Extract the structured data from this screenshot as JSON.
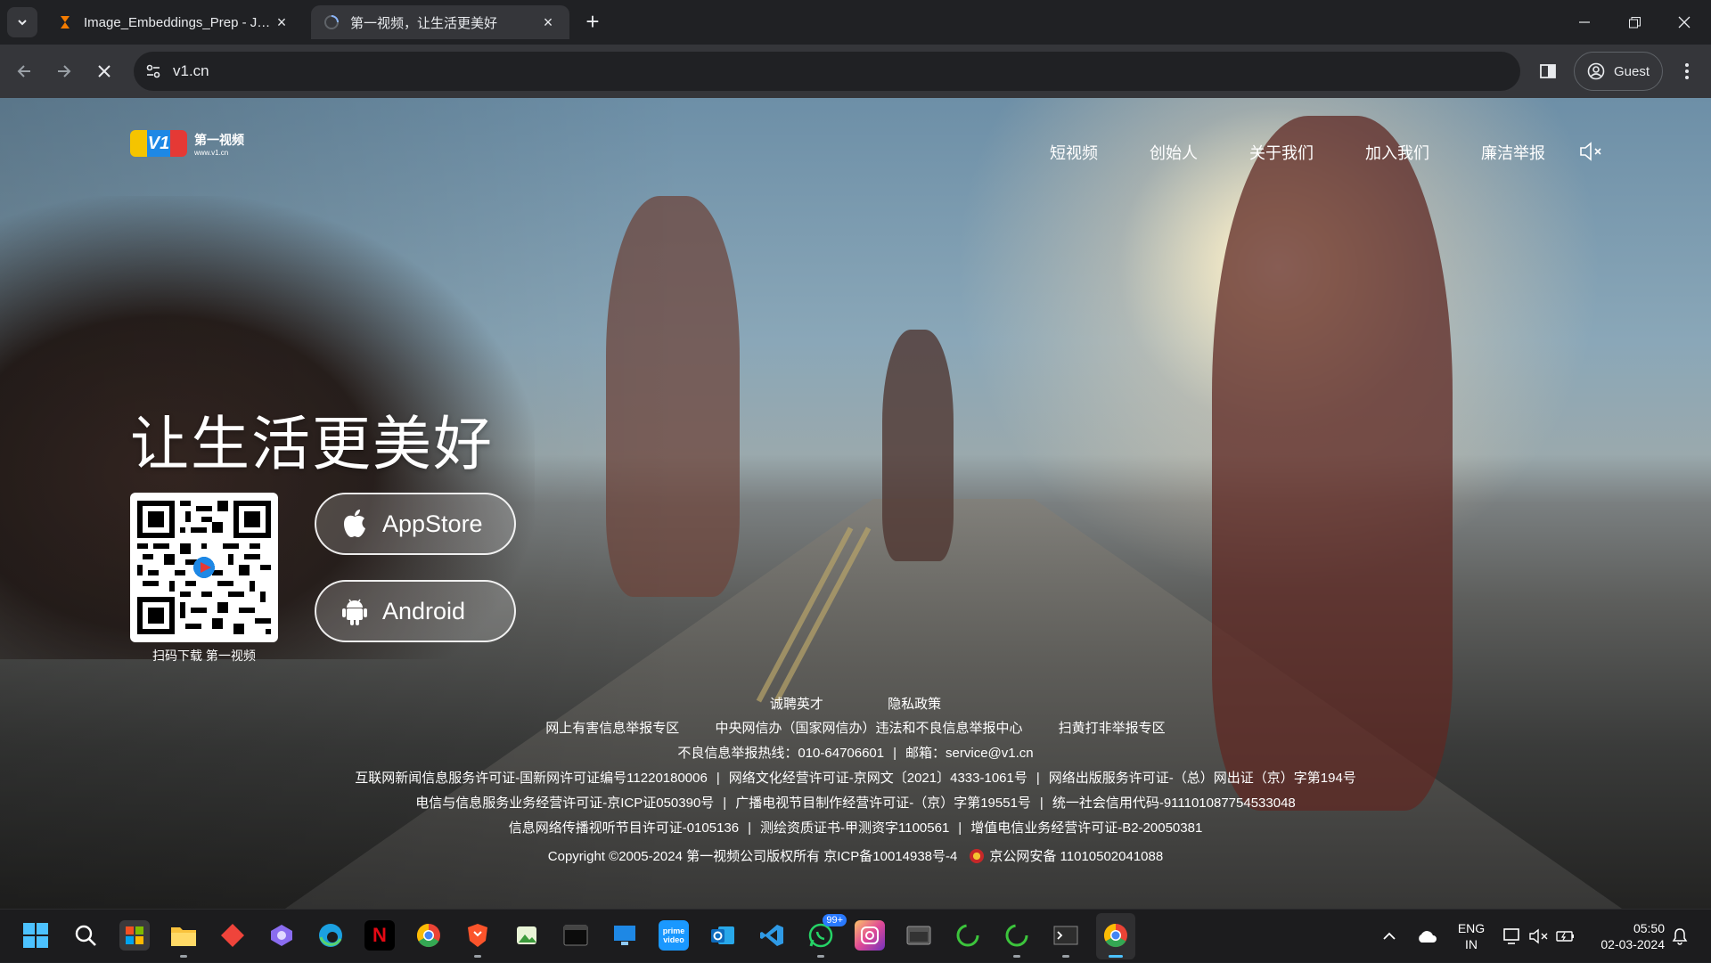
{
  "browser": {
    "tabs": [
      {
        "title": "Image_Embeddings_Prep - Jupyter",
        "active": false
      },
      {
        "title": "第一视频，让生活更美好",
        "active": true
      }
    ],
    "url": "v1.cn",
    "profile_label": "Guest"
  },
  "site": {
    "logo_cn": "第一视频",
    "logo_en": "www.v1.cn",
    "logo_mark": "V1",
    "nav": [
      "短视频",
      "创始人",
      "关于我们",
      "加入我们",
      "廉洁举报"
    ],
    "slogan": "让生活更美好",
    "qr_caption": "扫码下载 第一视频",
    "appstore_label": "AppStore",
    "android_label": "Android"
  },
  "footer": {
    "links_top": [
      "诚聘英才",
      "隐私政策"
    ],
    "links_report": [
      "网上有害信息举报专区",
      "中央网信办（国家网信办）违法和不良信息举报中心",
      "扫黄打非举报专区"
    ],
    "hotline": "不良信息举报热线：010-64706601",
    "email": "邮箱：service@v1.cn",
    "licenses_1": [
      "互联网新闻信息服务许可证-国新网许可证编号11220180006",
      "网络文化经营许可证-京网文〔2021〕4333-1061号",
      "网络出版服务许可证-（总）网出证（京）字第194号"
    ],
    "licenses_2": [
      "电信与信息服务业务经营许可证-京ICP证050390号",
      "广播电视节目制作经营许可证-（京）字第19551号",
      "统一社会信用代码-911101087754533048"
    ],
    "licenses_3": [
      "信息网络传播视听节目许可证-0105136",
      "测绘资质证书-甲测资字1100561",
      "增值电信业务经营许可证-B2-20050381"
    ],
    "copyright": "Copyright ©2005-2024   第一视频公司版权所有   京ICP备10014938号-4",
    "police": "京公网安备 11010502041088"
  },
  "taskbar": {
    "whatsapp_badge": "99+",
    "lang_top": "ENG",
    "lang_bottom": "IN",
    "time": "05:50",
    "date": "02-03-2024"
  },
  "colors": {
    "chrome_dark": "#202124",
    "chrome_mid": "#35363a",
    "taskbar": "#1c1c1e",
    "logo_yellow": "#f5c400",
    "logo_blue": "#1e88e5",
    "logo_red": "#e53935"
  }
}
